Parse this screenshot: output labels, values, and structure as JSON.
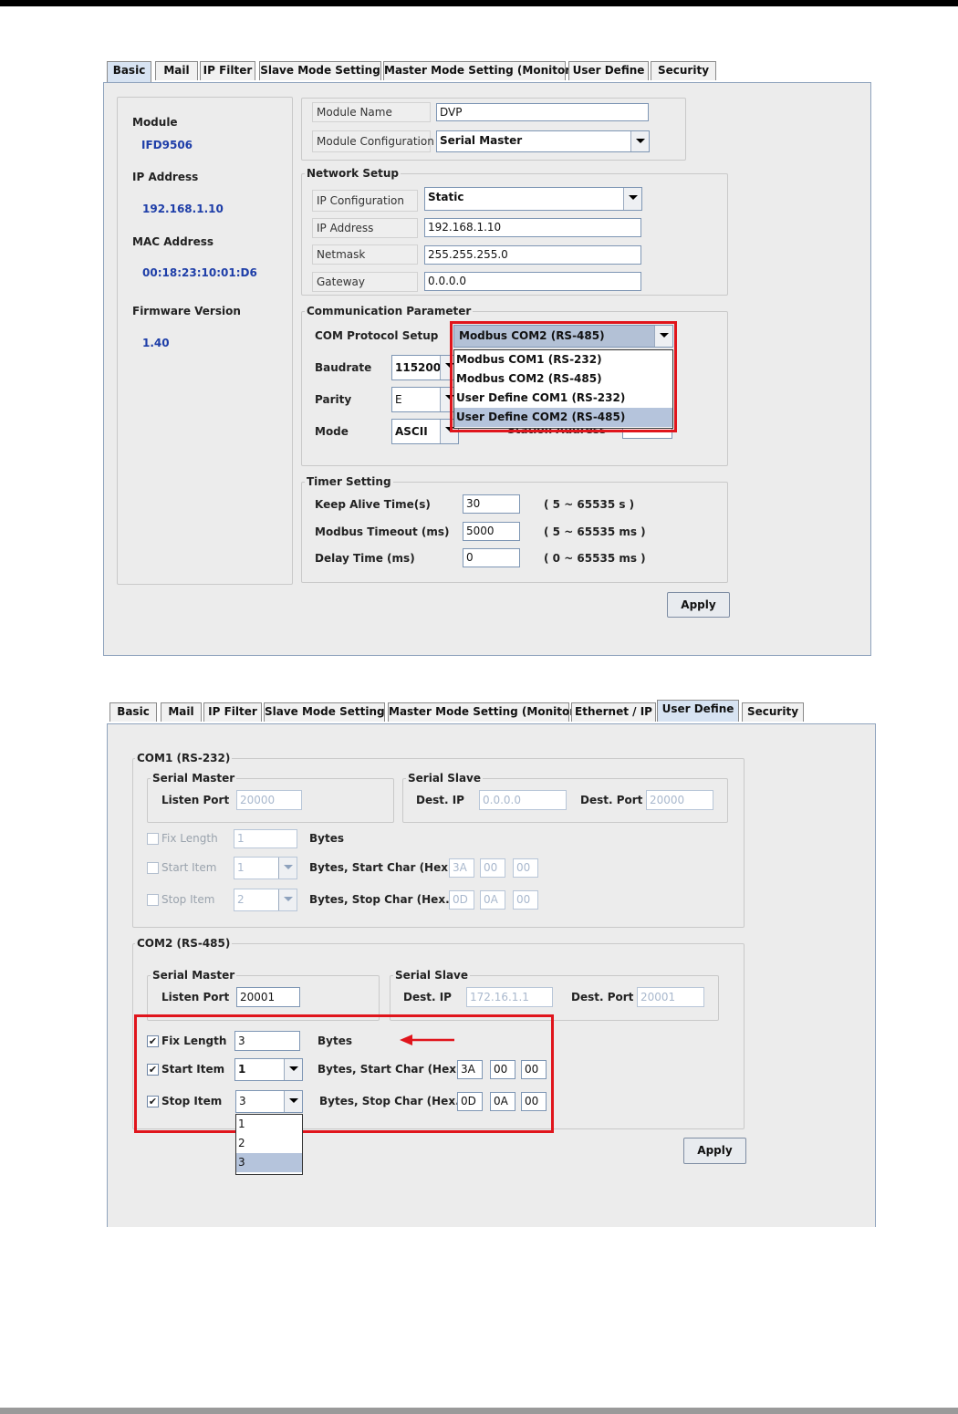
{
  "colors": {
    "highlight": "#e0151c",
    "value_text": "#1e3ea8",
    "panel_bg": "#ececec",
    "selected_item": "#b5c4dc"
  },
  "basic_screen": {
    "tabs": [
      "Basic",
      "Mail",
      "IP Filter",
      "Slave Mode Setting",
      "Master Mode Setting (Monitor)",
      "User Define",
      "Security"
    ],
    "active_tab": "Basic",
    "info": {
      "module_label": "Module",
      "module_value": "IFD9506",
      "ip_label": "IP Address",
      "ip_value": "192.168.1.10",
      "mac_label": "MAC Address",
      "mac_value": "00:18:23:10:01:D6",
      "fw_label": "Firmware Version",
      "fw_value": "1.40"
    },
    "module_name_label": "Module Name",
    "module_name_value": "DVP",
    "module_config_label": "Module Configuration",
    "module_config_value": "Serial Master",
    "network": {
      "title": "Network Setup",
      "ip_config_label": "IP Configuration",
      "ip_config_value": "Static",
      "ip_label": "IP Address",
      "ip_value": "192.168.1.10",
      "netmask_label": "Netmask",
      "netmask_value": "255.255.255.0",
      "gateway_label": "Gateway",
      "gateway_value": "0.0.0.0"
    },
    "comm": {
      "title": "Communication Parameter",
      "protocol_label": "COM Protocol Setup",
      "protocol_value": "Modbus COM2 (RS-485)",
      "protocol_options": [
        "Modbus COM1 (RS-232)",
        "Modbus COM2 (RS-485)",
        "User Define COM1 (RS-232)",
        "User Define COM2 (RS-485)"
      ],
      "protocol_highlighted": "User Define COM2 (RS-485)",
      "baudrate_label": "Baudrate",
      "baudrate_value": "115200",
      "parity_label": "Parity",
      "parity_value": "E",
      "mode_label": "Mode",
      "mode_value": "ASCII",
      "station_label": "Station Address"
    },
    "timer": {
      "title": "Timer Setting",
      "keepalive_label": "Keep Alive Time(s)",
      "keepalive_value": "30",
      "keepalive_range": "( 5 ~ 65535 s )",
      "timeout_label": "Modbus Timeout (ms)",
      "timeout_value": "5000",
      "timeout_range": "( 5 ~ 65535 ms )",
      "delay_label": "Delay Time (ms)",
      "delay_value": "0",
      "delay_range": "( 0 ~ 65535 ms )"
    },
    "apply": "Apply"
  },
  "userdefine_screen": {
    "tabs": [
      "Basic",
      "Mail",
      "IP Filter",
      "Slave Mode Setting",
      "Master Mode Setting (Monitor)",
      "Ethernet / IP",
      "User Define",
      "Security"
    ],
    "active_tab": "User Define",
    "com1": {
      "title": "COM1 (RS-232)",
      "serial_master": "Serial Master",
      "listen_port_label": "Listen Port",
      "listen_port": "20000",
      "serial_slave": "Serial Slave",
      "dest_ip_label": "Dest. IP",
      "dest_ip": "0.0.0.0",
      "dest_port_label": "Dest. Port",
      "dest_port": "20000",
      "fix_length_label": "Fix Length",
      "fix_length": "1",
      "bytes_label": "Bytes",
      "start_item_label": "Start Item",
      "start_item": "1",
      "start_char_label": "Bytes, Start Char (Hex.)",
      "start_chars": [
        "3A",
        "00",
        "00"
      ],
      "stop_item_label": "Stop Item",
      "stop_item": "2",
      "stop_char_label": "Bytes, Stop Char (Hex.)",
      "stop_chars": [
        "0D",
        "0A",
        "00"
      ]
    },
    "com2": {
      "title": "COM2 (RS-485)",
      "serial_master": "Serial Master",
      "listen_port_label": "Listen Port",
      "listen_port": "20001",
      "serial_slave": "Serial Slave",
      "dest_ip_label": "Dest. IP",
      "dest_ip": "172.16.1.1",
      "dest_port_label": "Dest. Port",
      "dest_port": "20001",
      "fix_length_label": "Fix Length",
      "fix_length": "3",
      "bytes_label": "Bytes",
      "start_item_label": "Start Item",
      "start_item": "1",
      "start_char_label": "Bytes, Start Char (Hex.)",
      "start_chars": [
        "3A",
        "00",
        "00"
      ],
      "stop_item_label": "Stop Item",
      "stop_item": "3",
      "stop_char_label": "Bytes, Stop Char (Hex.)",
      "stop_chars": [
        "0D",
        "0A",
        "00"
      ],
      "stop_options": [
        "1",
        "2",
        "3"
      ],
      "stop_selected": "3"
    },
    "apply": "Apply"
  }
}
